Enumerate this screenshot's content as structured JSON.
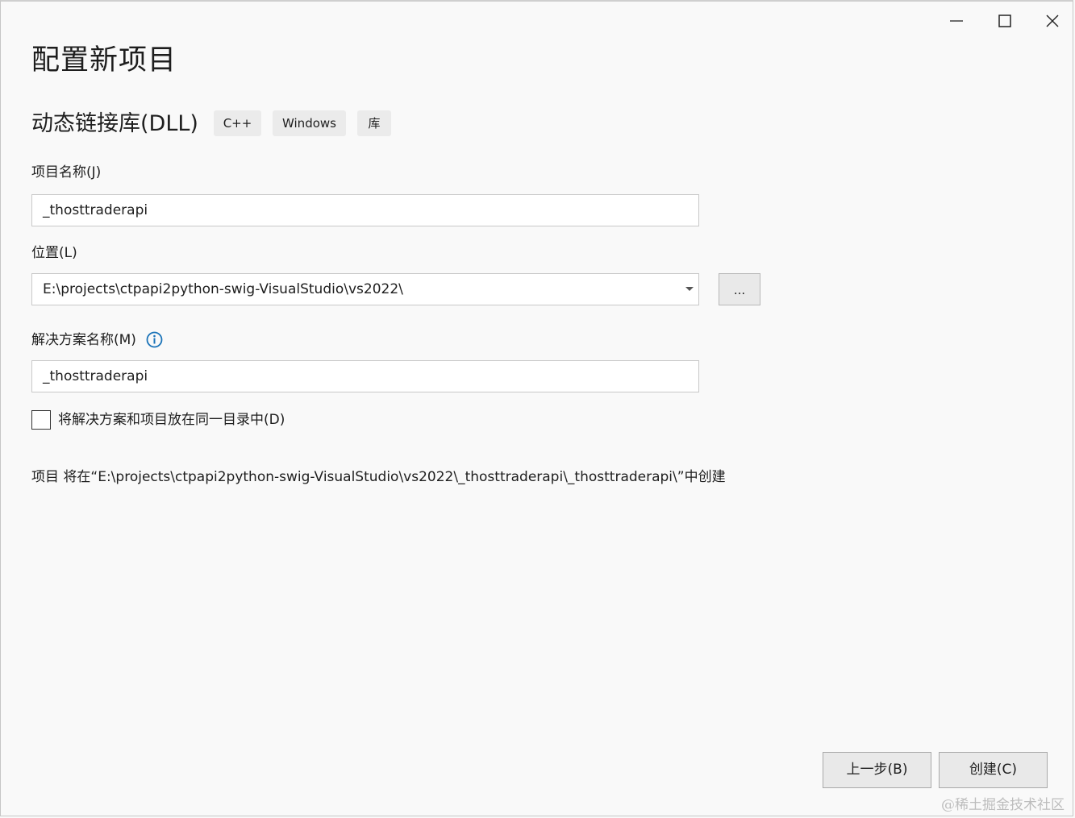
{
  "dialog": {
    "title": "配置新项目",
    "template_name": "动态链接库(DLL)",
    "tags": [
      "C++",
      "Windows",
      "库"
    ]
  },
  "project_name": {
    "label": "项目名称(J)",
    "value": "_thosttraderapi"
  },
  "location": {
    "label": "位置(L)",
    "value": "E:\\projects\\ctpapi2python-swig-VisualStudio\\vs2022\\",
    "browse_label": "..."
  },
  "solution_name": {
    "label": "解决方案名称(M)",
    "value": "_thosttraderapi",
    "info_icon": "info-icon"
  },
  "same_directory": {
    "label": "将解决方案和项目放在同一目录中(D)",
    "checked": false
  },
  "path_summary": "项目 将在“E:\\projects\\ctpapi2python-swig-VisualStudio\\vs2022\\_thosttraderapi\\_thosttraderapi\\”中创建",
  "buttons": {
    "back": "上一步(B)",
    "create": "创建(C)"
  },
  "watermark": "@稀土掘金技术社区",
  "colors": {
    "background": "#f9f9f9",
    "info_icon": "#1a73b8"
  }
}
